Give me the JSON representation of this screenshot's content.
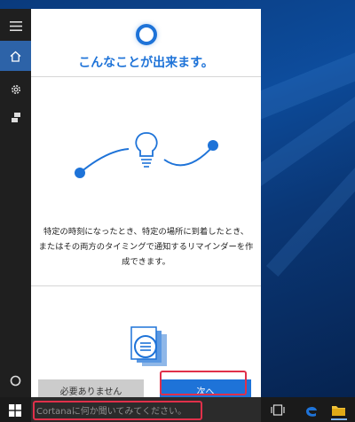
{
  "cortana": {
    "title": "こんなことが出来ます。",
    "description_lines": [
      "特定の時刻になったとき、特定の場所に到着したとき、",
      "またはその両方のタイミングで通知するリマインダーを作",
      "成できます。"
    ],
    "skip_button": "必要ありません",
    "next_button": "次へ"
  },
  "sidebar": {
    "items": [
      {
        "icon": "hamburger-menu-icon"
      },
      {
        "icon": "home-icon",
        "active": true
      },
      {
        "icon": "gear-icon"
      },
      {
        "icon": "feedback-icon"
      },
      {
        "icon": "cortana-circle-icon"
      }
    ]
  },
  "taskbar": {
    "search_placeholder": "Cortanaに何か聞いてみてください。",
    "icons": [
      "windows-start-icon",
      "task-view-icon",
      "edge-icon",
      "file-explorer-icon"
    ]
  },
  "colors": {
    "accent": "#1e73d8",
    "highlight": "#e0304a",
    "rail": "#1f1f1f",
    "active_rail": "#2d63a8"
  }
}
